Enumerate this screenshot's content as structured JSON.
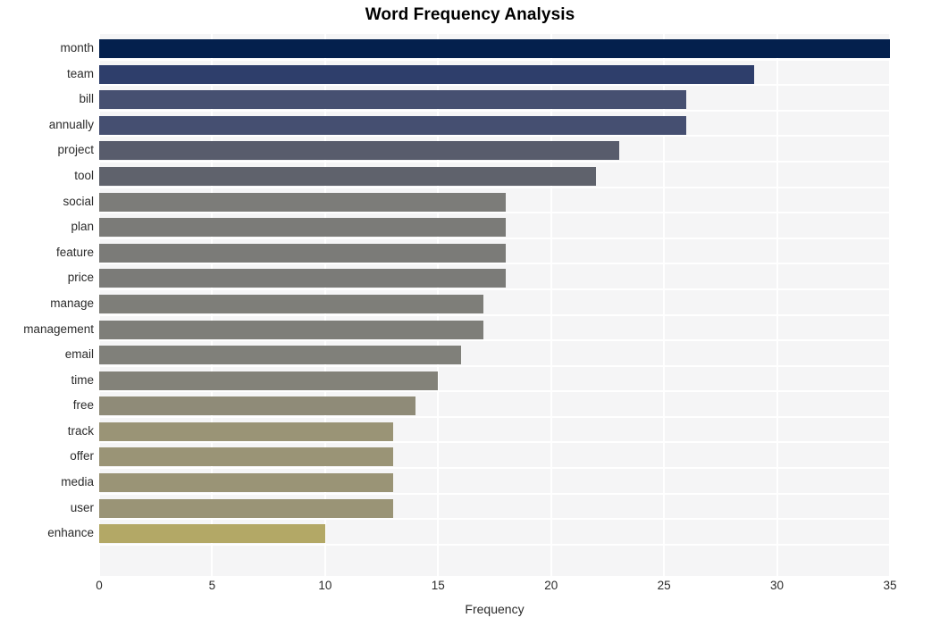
{
  "chart_data": {
    "type": "bar",
    "orientation": "horizontal",
    "title": "Word Frequency Analysis",
    "xlabel": "Frequency",
    "ylabel": "",
    "xlim": [
      0,
      35
    ],
    "x_ticks": [
      0,
      5,
      10,
      15,
      20,
      25,
      30,
      35
    ],
    "x_tick_labels": [
      "0",
      "5",
      "10",
      "15",
      "20",
      "25",
      "30",
      "35"
    ],
    "grid": true,
    "grid_color": "#ffffff",
    "plot_background": "#f5f5f6",
    "figure_background": "#ffffff",
    "legend": null,
    "categories": [
      "month",
      "team",
      "bill",
      "annually",
      "project",
      "tool",
      "social",
      "plan",
      "feature",
      "price",
      "manage",
      "management",
      "email",
      "time",
      "free",
      "track",
      "offer",
      "media",
      "user",
      "enhance"
    ],
    "values": [
      35,
      29,
      26,
      26,
      23,
      22,
      18,
      18,
      18,
      18,
      17,
      17,
      16,
      15,
      14,
      13,
      13,
      13,
      13,
      10
    ],
    "bar_colors": [
      "#04204d",
      "#2e3e6b",
      "#465071",
      "#454f71",
      "#585c6c",
      "#5f626c",
      "#7c7c79",
      "#7b7b78",
      "#7b7b78",
      "#7b7b78",
      "#7e7e79",
      "#7e7e79",
      "#80807a",
      "#838279",
      "#8f8b78",
      "#9a9476",
      "#9a9476",
      "#9a9476",
      "#9a9476",
      "#b3a866"
    ]
  }
}
